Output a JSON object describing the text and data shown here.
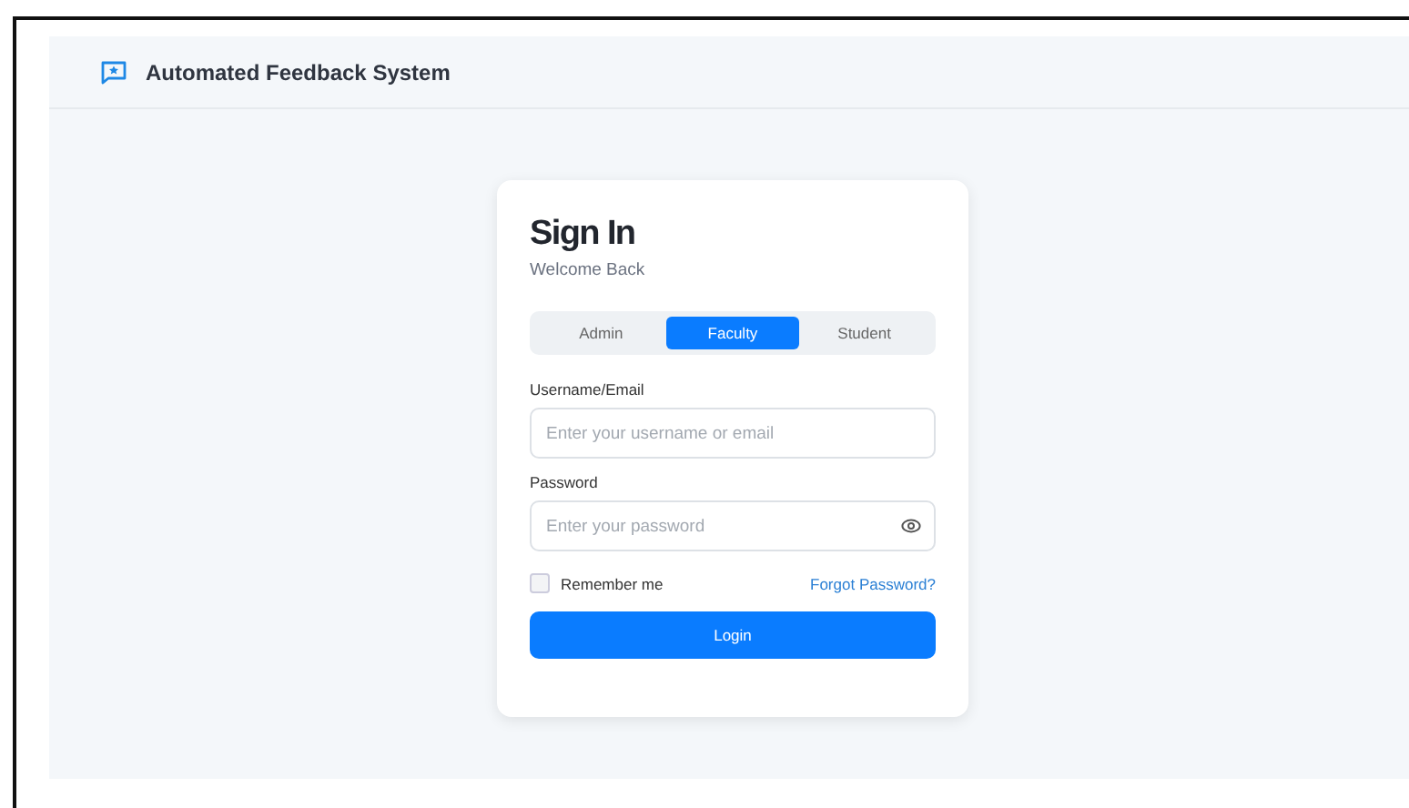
{
  "header": {
    "title": "Automated Feedback System"
  },
  "card": {
    "title": "Sign In",
    "subtitle": "Welcome Back",
    "roles": [
      {
        "label": "Admin",
        "selected": false
      },
      {
        "label": "Faculty",
        "selected": true
      },
      {
        "label": "Student",
        "selected": false
      }
    ],
    "fields": [
      {
        "label": "Username/Email",
        "placeholder": "Enter your username or email",
        "kind": "text"
      },
      {
        "label": "Password",
        "placeholder": "Enter your password",
        "kind": "password"
      }
    ],
    "remember": {
      "label": "Remember me",
      "checked": false
    },
    "forgot": "Forgot Password?",
    "button": "Login"
  }
}
